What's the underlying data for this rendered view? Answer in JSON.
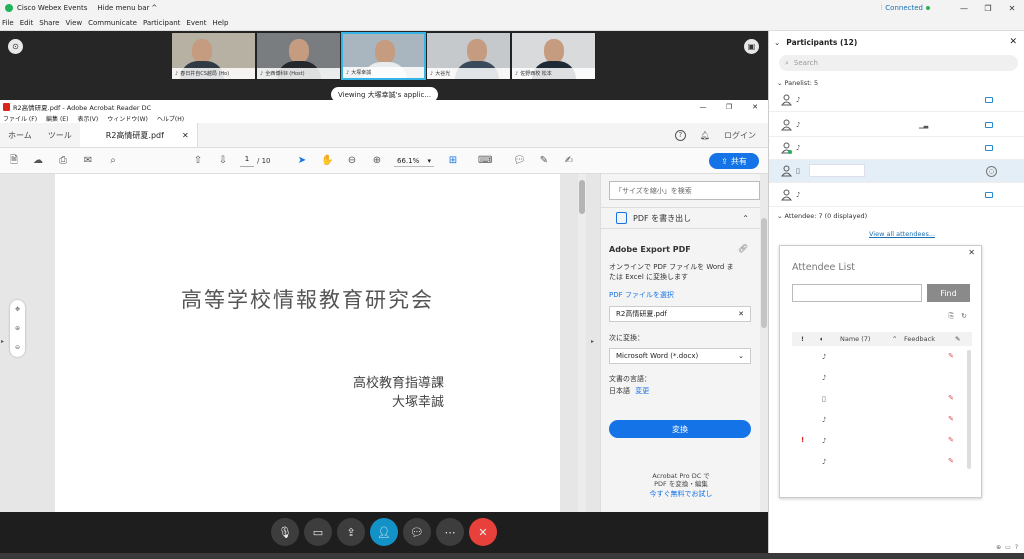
{
  "app": {
    "title": "Cisco Webex Events",
    "hide_menu_bar": "Hide menu bar",
    "status": "Connected",
    "menu": [
      "File",
      "Edit",
      "Share",
      "View",
      "Communicate",
      "Participant",
      "Event",
      "Help"
    ]
  },
  "video": {
    "viewing_label": "Viewing 大塚幸誠's applic...",
    "thumbnails": [
      {
        "name": "春日井自CS越局 (Ho)",
        "active": false
      },
      {
        "name": "全西博科Ⅱ (Host)",
        "active": false
      },
      {
        "name": "大塚幸誠",
        "active": true
      },
      {
        "name": "大谷光",
        "active": false
      },
      {
        "name": "佐野西校 松本",
        "active": false
      }
    ]
  },
  "acrobat": {
    "window_title": "R2高情研夏.pdf - Adobe Acrobat Reader DC",
    "menu": [
      "ファイル (F)",
      "編集 (E)",
      "表示(V)",
      "ウィンドウ(W)",
      "ヘルプ(H)"
    ],
    "tabs": {
      "home": "ホーム",
      "tools": "ツール",
      "doc": "R2高情研夏.pdf"
    },
    "login": "ログイン",
    "page_current": "1",
    "page_total": "/ 10",
    "zoom": "66.1%",
    "share": "共有",
    "page": {
      "title": "高等学校情報教育研究会",
      "line1": "高校教育指導課",
      "line2": "大塚幸誠"
    },
    "panel": {
      "search_placeholder": "「サイズを縮小」を検索",
      "export_header": "PDF を書き出し",
      "export_title": "Adobe Export PDF",
      "export_desc1": "オンラインで PDF ファイルを Word ま",
      "export_desc2": "たは Excel に変換します",
      "select_file": "PDF ファイルを選択",
      "file_name": "R2高情研夏.pdf",
      "convert_to": "次に変換：",
      "format": "Microsoft Word (*.docx)",
      "lang_label": "文書の言語：",
      "lang_value": "日本語",
      "lang_change": "変更",
      "convert_button": "変換",
      "promo1": "Acrobat Pro DC で",
      "promo2": "PDF を変換・編集",
      "promo_link": "今すぐ無料でお試し"
    }
  },
  "participants": {
    "header": "Participants (12)",
    "search_placeholder": "Search",
    "panelist_label": "Panelist: 5",
    "attendee_label": "Attendee: 7 (0 displayed)",
    "view_all": "View all attendees...",
    "attendee_list": {
      "title": "Attendee List",
      "find": "Find",
      "col_name": "Name (7)",
      "col_feedback": "Feedback"
    }
  },
  "colors": {
    "accent_blue": "#1473e6",
    "webex_green": "#1fb35b",
    "end_red": "#e8403b",
    "participant_teal": "#1392c8"
  }
}
